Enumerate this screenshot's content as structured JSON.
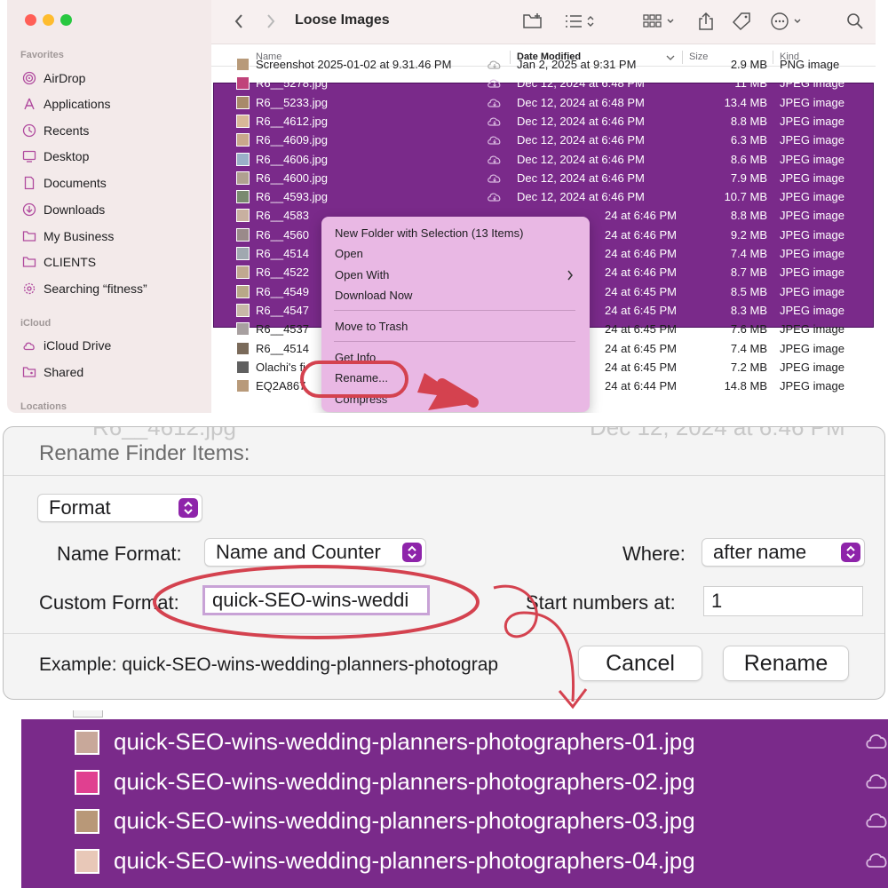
{
  "finder": {
    "sidebar": {
      "favorites_heading": "Favorites",
      "icloud_heading": "iCloud",
      "locations_heading": "Locations",
      "favorites": [
        {
          "label": "AirDrop",
          "icon": "airdrop-icon"
        },
        {
          "label": "Applications",
          "icon": "applications-icon"
        },
        {
          "label": "Recents",
          "icon": "clock-icon"
        },
        {
          "label": "Desktop",
          "icon": "desktop-icon"
        },
        {
          "label": "Documents",
          "icon": "document-icon"
        },
        {
          "label": "Downloads",
          "icon": "download-icon"
        },
        {
          "label": "My Business",
          "icon": "folder-icon"
        },
        {
          "label": "CLIENTS",
          "icon": "folder-icon"
        },
        {
          "label": "Searching “fitness”",
          "icon": "gear-icon"
        }
      ],
      "icloud": [
        {
          "label": "iCloud Drive",
          "icon": "cloud-icon"
        },
        {
          "label": "Shared",
          "icon": "shared-folder-icon"
        }
      ]
    },
    "toolbar": {
      "title": "Loose Images"
    },
    "columns": {
      "name": "Name",
      "date": "Date Modified",
      "size": "Size",
      "kind": "Kind"
    },
    "rows": [
      {
        "name": "Screenshot 2025-01-02 at 9.31.46 PM",
        "date": "Jan 2, 2025 at 9:31 PM",
        "size": "2.9 MB",
        "kind": "PNG image",
        "selected": false
      },
      {
        "name": "R6__5278.jpg",
        "date": "Dec 12, 2024 at 6:48 PM",
        "size": "11 MB",
        "kind": "JPEG image",
        "selected": true
      },
      {
        "name": "R6__5233.jpg",
        "date": "Dec 12, 2024 at 6:48 PM",
        "size": "13.4 MB",
        "kind": "JPEG image",
        "selected": true
      },
      {
        "name": "R6__4612.jpg",
        "date": "Dec 12, 2024 at 6:46 PM",
        "size": "8.8 MB",
        "kind": "JPEG image",
        "selected": true
      },
      {
        "name": "R6__4609.jpg",
        "date": "Dec 12, 2024 at 6:46 PM",
        "size": "6.3 MB",
        "kind": "JPEG image",
        "selected": true
      },
      {
        "name": "R6__4606.jpg",
        "date": "Dec 12, 2024 at 6:46 PM",
        "size": "8.6 MB",
        "kind": "JPEG image",
        "selected": true
      },
      {
        "name": "R6__4600.jpg",
        "date": "Dec 12, 2024 at 6:46 PM",
        "size": "7.9 MB",
        "kind": "JPEG image",
        "selected": true
      },
      {
        "name": "R6__4593.jpg",
        "date": "Dec 12, 2024 at 6:46 PM",
        "size": "10.7 MB",
        "kind": "JPEG image",
        "selected": true
      },
      {
        "name": "R6__4583",
        "date": "24 at 6:46 PM",
        "size": "8.8 MB",
        "kind": "JPEG image",
        "selected": true
      },
      {
        "name": "R6__4560",
        "date": "24 at 6:46 PM",
        "size": "9.2 MB",
        "kind": "JPEG image",
        "selected": true
      },
      {
        "name": "R6__4514",
        "date": "24 at 6:46 PM",
        "size": "7.4 MB",
        "kind": "JPEG image",
        "selected": true
      },
      {
        "name": "R6__4522",
        "date": "24 at 6:46 PM",
        "size": "8.7 MB",
        "kind": "JPEG image",
        "selected": true
      },
      {
        "name": "R6__4549",
        "date": "24 at 6:45 PM",
        "size": "8.5 MB",
        "kind": "JPEG image",
        "selected": true
      },
      {
        "name": "R6__4547",
        "date": "24 at 6:45 PM",
        "size": "8.3 MB",
        "kind": "JPEG image",
        "selected": true
      },
      {
        "name": "R6__4537",
        "date": "24 at 6:45 PM",
        "size": "7.6 MB",
        "kind": "JPEG image",
        "selected": false
      },
      {
        "name": "R6__4514",
        "date": "24 at 6:45 PM",
        "size": "7.4 MB",
        "kind": "JPEG image",
        "selected": false
      },
      {
        "name": "Olachi's fi",
        "date": "24 at 6:45 PM",
        "size": "7.2 MB",
        "kind": "JPEG image",
        "selected": false
      },
      {
        "name": "EQ2A867",
        "date": "24 at 6:44 PM",
        "size": "14.8 MB",
        "kind": "JPEG image",
        "selected": false
      }
    ],
    "context_menu": {
      "new_folder": "New Folder with Selection (13 Items)",
      "open": "Open",
      "open_with": "Open With",
      "download_now": "Download Now",
      "move_to_trash": "Move to Trash",
      "get_info": "Get Info",
      "rename": "Rename...",
      "compress": "Compress"
    }
  },
  "dialog": {
    "ghost_name": "R6__4612.jpg",
    "ghost_date": "Dec 12, 2024 at 6:46 PM",
    "title": "Rename Finder Items:",
    "mode": "Format",
    "name_format_label": "Name Format:",
    "name_format_value": "Name and Counter",
    "where_label": "Where:",
    "where_value": "after name",
    "custom_format_label": "Custom Format:",
    "custom_format_value": "quick-SEO-wins-weddi",
    "start_numbers_label": "Start numbers at:",
    "start_numbers_value": "1",
    "example": "Example: quick-SEO-wins-wedding-planners-photograp",
    "cancel": "Cancel",
    "rename": "Rename"
  },
  "results": {
    "files": [
      "quick-SEO-wins-wedding-planners-photographers-01.jpg",
      "quick-SEO-wins-wedding-planners-photographers-02.jpg",
      "quick-SEO-wins-wedding-planners-photographers-03.jpg",
      "quick-SEO-wins-wedding-planners-photographers-04.jpg"
    ]
  },
  "colors": {
    "selection": "#7a2a8a",
    "selection_border": "#4a0d5c",
    "context_menu_bg": "#e9b8e4",
    "annotation": "#d4424f",
    "popup_chevron": "#8e24aa"
  }
}
